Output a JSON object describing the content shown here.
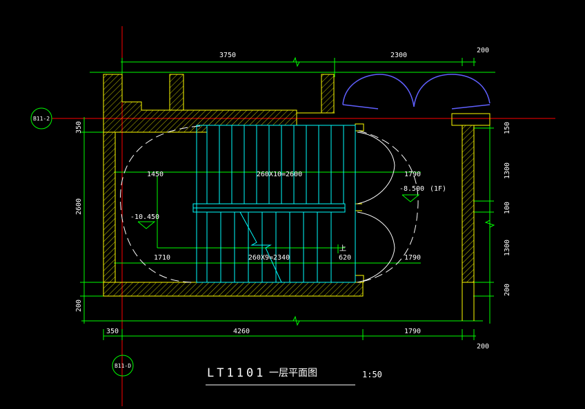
{
  "colors": {
    "background": "#000000",
    "dimension": "#00ff00",
    "wall": "#ffff00",
    "stair": "#00ffff",
    "axis": "#ff0000",
    "door": "#0000ff",
    "text": "#ffffff"
  },
  "axes": {
    "top": "B11-2",
    "bottom": "B11-D"
  },
  "dimensions": {
    "top_left": "3750",
    "top_mid": "2300",
    "top_right": "200",
    "left_1": "350",
    "left_2": "2600",
    "left_3": "200",
    "right_1": "150",
    "right_2": "1300",
    "right_3": "100",
    "right_4": "1300",
    "right_5": "200",
    "bottom_1": "350",
    "bottom_2": "4260",
    "bottom_3": "1790",
    "bottom_4": "200"
  },
  "interior": {
    "upper_left": "1450",
    "upper_run": "260X10=2600",
    "upper_right": "1790",
    "level_upper": "-8.500",
    "floor_tag": "(1F)",
    "level_lower": "-10.450",
    "lower_left": "1710",
    "lower_run": "260X9=2340",
    "lower_mid": "620",
    "lower_right": "1790",
    "up_marker": "上"
  },
  "title": {
    "code": "LT1101",
    "name": "一层平面图",
    "scale": "1:50"
  }
}
